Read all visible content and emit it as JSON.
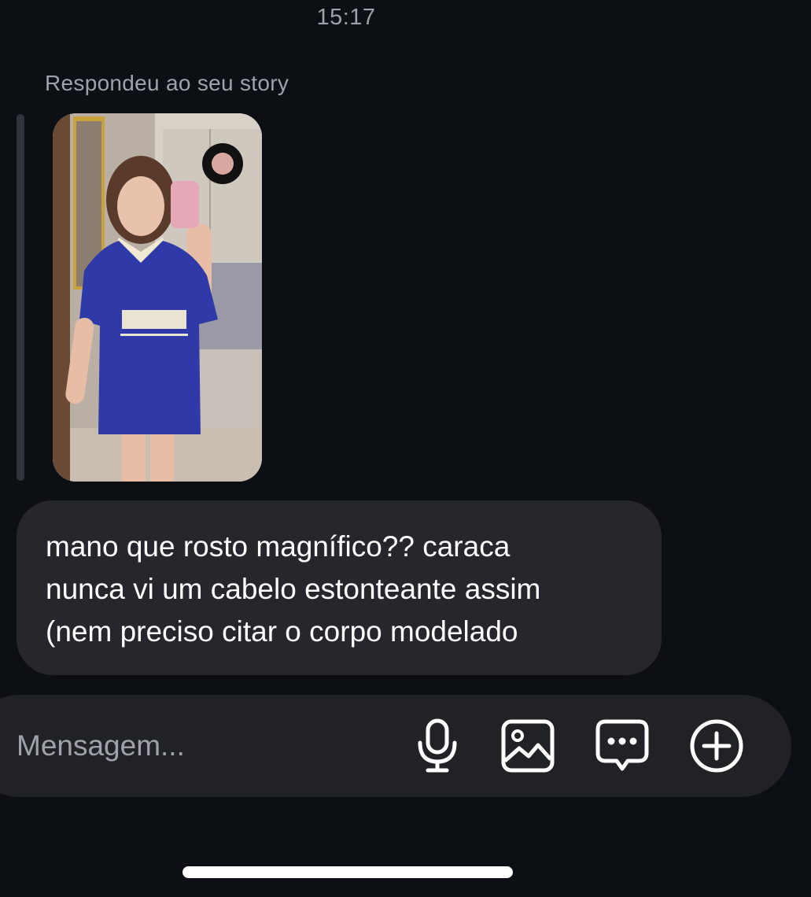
{
  "status": {
    "time": "15:17"
  },
  "conversation": {
    "reply_context": {
      "label": "Respondeu ao seu story",
      "thumbnail_icon": "story-photo"
    },
    "message": {
      "lines": [
        "mano que rosto magnífico?? caraca",
        "nunca vi um cabelo estonteante assim",
        "(nem preciso citar o corpo modelado"
      ]
    }
  },
  "composer": {
    "placeholder": "Mensagem...",
    "value": "",
    "icons": [
      "microphone-icon",
      "gallery-icon",
      "sticker-chat-icon",
      "plus-circle-icon"
    ]
  },
  "colors": {
    "background": "#0c0f14",
    "bubble": "#25272c",
    "composer": "#202226",
    "muted_text": "#9ea3ab",
    "shirt_blue": "#2f3aa8"
  }
}
